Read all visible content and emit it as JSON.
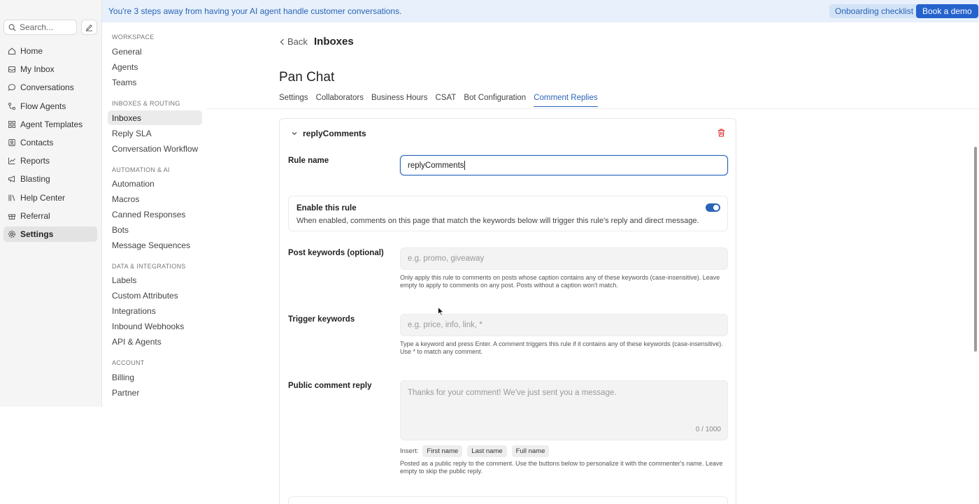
{
  "banner": {
    "text": "You're 3 steps away from having your AI agent handle customer conversations.",
    "onboarding_label": "Onboarding checklist",
    "demo_label": "Book a demo"
  },
  "leftnav": {
    "search_placeholder": "Search...",
    "items": [
      {
        "label": "Home",
        "icon": "home-icon"
      },
      {
        "label": "My Inbox",
        "icon": "inbox-icon"
      },
      {
        "label": "Conversations",
        "icon": "chat-bubble-icon"
      },
      {
        "label": "Flow Agents",
        "icon": "flow-icon"
      },
      {
        "label": "Agent Templates",
        "icon": "grid-icon"
      },
      {
        "label": "Contacts",
        "icon": "contact-card-icon"
      },
      {
        "label": "Reports",
        "icon": "chart-line-icon"
      },
      {
        "label": "Blasting",
        "icon": "megaphone-icon"
      },
      {
        "label": "Help Center",
        "icon": "library-icon"
      },
      {
        "label": "Referral",
        "icon": "gift-icon"
      },
      {
        "label": "Settings",
        "icon": "gear-icon",
        "active": true
      }
    ]
  },
  "subnav": {
    "sections": [
      {
        "title": "WORKSPACE",
        "items": [
          "General",
          "Agents",
          "Teams"
        ]
      },
      {
        "title": "INBOXES & ROUTING",
        "items": [
          "Inboxes",
          "Reply SLA",
          "Conversation Workflow"
        ]
      },
      {
        "title": "AUTOMATION & AI",
        "items": [
          "Automation",
          "Macros",
          "Canned Responses",
          "Bots",
          "Message Sequences"
        ]
      },
      {
        "title": "DATA & INTEGRATIONS",
        "items": [
          "Labels",
          "Custom Attributes",
          "Integrations",
          "Inbound Webhooks",
          "API & Agents"
        ]
      },
      {
        "title": "ACCOUNT",
        "items": [
          "Billing",
          "Partner"
        ]
      }
    ],
    "active": "Inboxes"
  },
  "header": {
    "back_label": "Back",
    "breadcrumb": "Inboxes",
    "page_title": "Pan Chat"
  },
  "tabs": [
    "Settings",
    "Collaborators",
    "Business Hours",
    "CSAT",
    "Bot Configuration",
    "Comment Replies"
  ],
  "active_tab": "Comment Replies",
  "rule": {
    "name": "replyComments",
    "rule_name_label": "Rule name",
    "rule_name_value": "replyComments",
    "enable_title": "Enable this rule",
    "enable_desc": "When enabled, comments on this page that match the keywords below will trigger this rule's reply and direct message.",
    "enabled": true,
    "post_keywords_label": "Post keywords (optional)",
    "post_keywords_placeholder": "e.g. promo, giveaway",
    "post_keywords_help": "Only apply this rule to comments on posts whose caption contains any of these keywords (case-insensitive). Leave empty to apply to comments on any post. Posts without a caption won't match.",
    "trigger_label": "Trigger keywords",
    "trigger_placeholder": "e.g. price, info, link, *",
    "trigger_help": "Type a keyword and press Enter. A comment triggers this rule if it contains any of these keywords (case-insensitive). Use * to match any comment.",
    "public_reply_label": "Public comment reply",
    "public_reply_placeholder": "Thanks for your comment! We've just sent you a message.",
    "char_count": "0 / 1000",
    "insert_label": "Insert:",
    "insert_chips": [
      "First name",
      "Last name",
      "Full name"
    ],
    "public_reply_help": "Posted as a public reply to the comment. Use the buttons below to personalize it with the commenter's name. Leave empty to skip the public reply."
  },
  "colors": {
    "accent": "#2a64b7",
    "banner_bg": "#e7f0fb",
    "demo_button": "#2563cc"
  }
}
